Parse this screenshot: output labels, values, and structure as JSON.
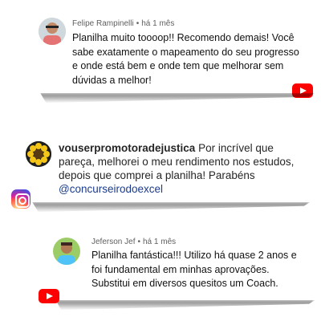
{
  "comments": [
    {
      "author": "Felipe Rampinelli",
      "time": "há 1 mês",
      "text": "Planilha muito toooop!! Recomendo demais! Você sabe exatamente o mapeamento do seu progresso e onde está bem e onde tem que melhorar sem dúvidas a melhor!",
      "platform": "youtube-icon"
    },
    {
      "author": "vouserpromotoradejustica",
      "text": "Por incrível que pareça, melhorei o meu rendimento nos estudos, depois que comprei a planilha! Parabéns",
      "mention": "@concurseirodoexcel",
      "platform": "instagram-icon"
    },
    {
      "author": "Jeferson Jef",
      "time": "há 1 mês",
      "text": "Planilha fantástica!!! Utilizo há quase 2 anos e foi fundamental em minhas aprovações. Substitui em diversos quesitos um Coach.",
      "platform": "youtube-icon"
    }
  ],
  "colors": {
    "youtube": "#ff0000",
    "mention": "#1b3b8c",
    "meta": "#606060"
  }
}
